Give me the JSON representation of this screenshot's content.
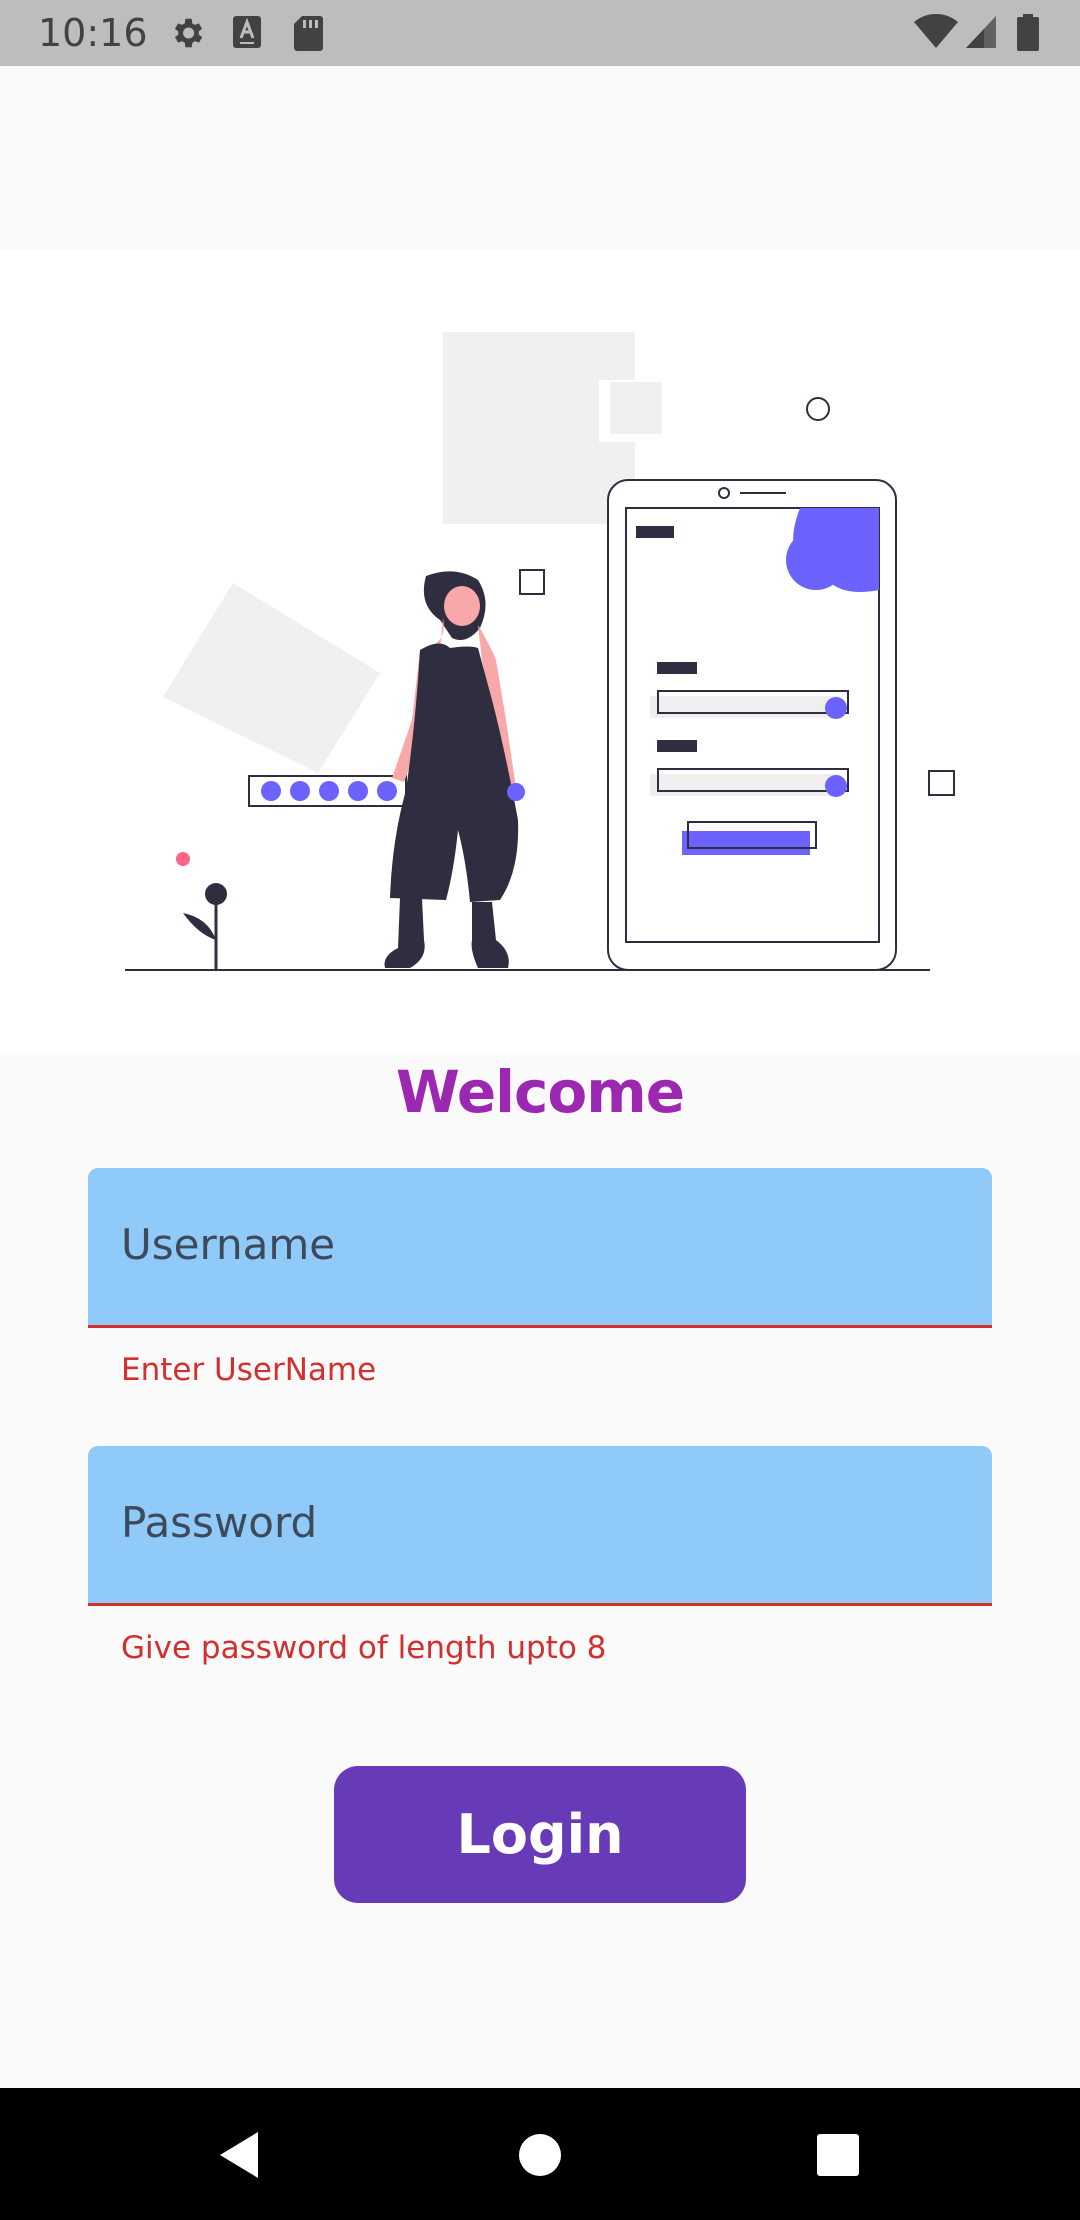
{
  "status_bar": {
    "time": "10:16",
    "icons": [
      "gear-icon",
      "a-icon",
      "sd-card-icon",
      "wifi-icon",
      "signal-icon",
      "battery-icon"
    ]
  },
  "illustration": {
    "accent_color": "#6c63ff",
    "dark_color": "#2f2e41",
    "pink_color": "#ff6584"
  },
  "form": {
    "welcome": "Welcome",
    "username": {
      "placeholder": "Username",
      "helper": "Enter UserName"
    },
    "password": {
      "placeholder": "Password",
      "helper": "Give password of length upto 8"
    },
    "login_label": "Login"
  },
  "nav": {
    "icons": [
      "back-icon",
      "home-icon",
      "recents-icon"
    ]
  }
}
